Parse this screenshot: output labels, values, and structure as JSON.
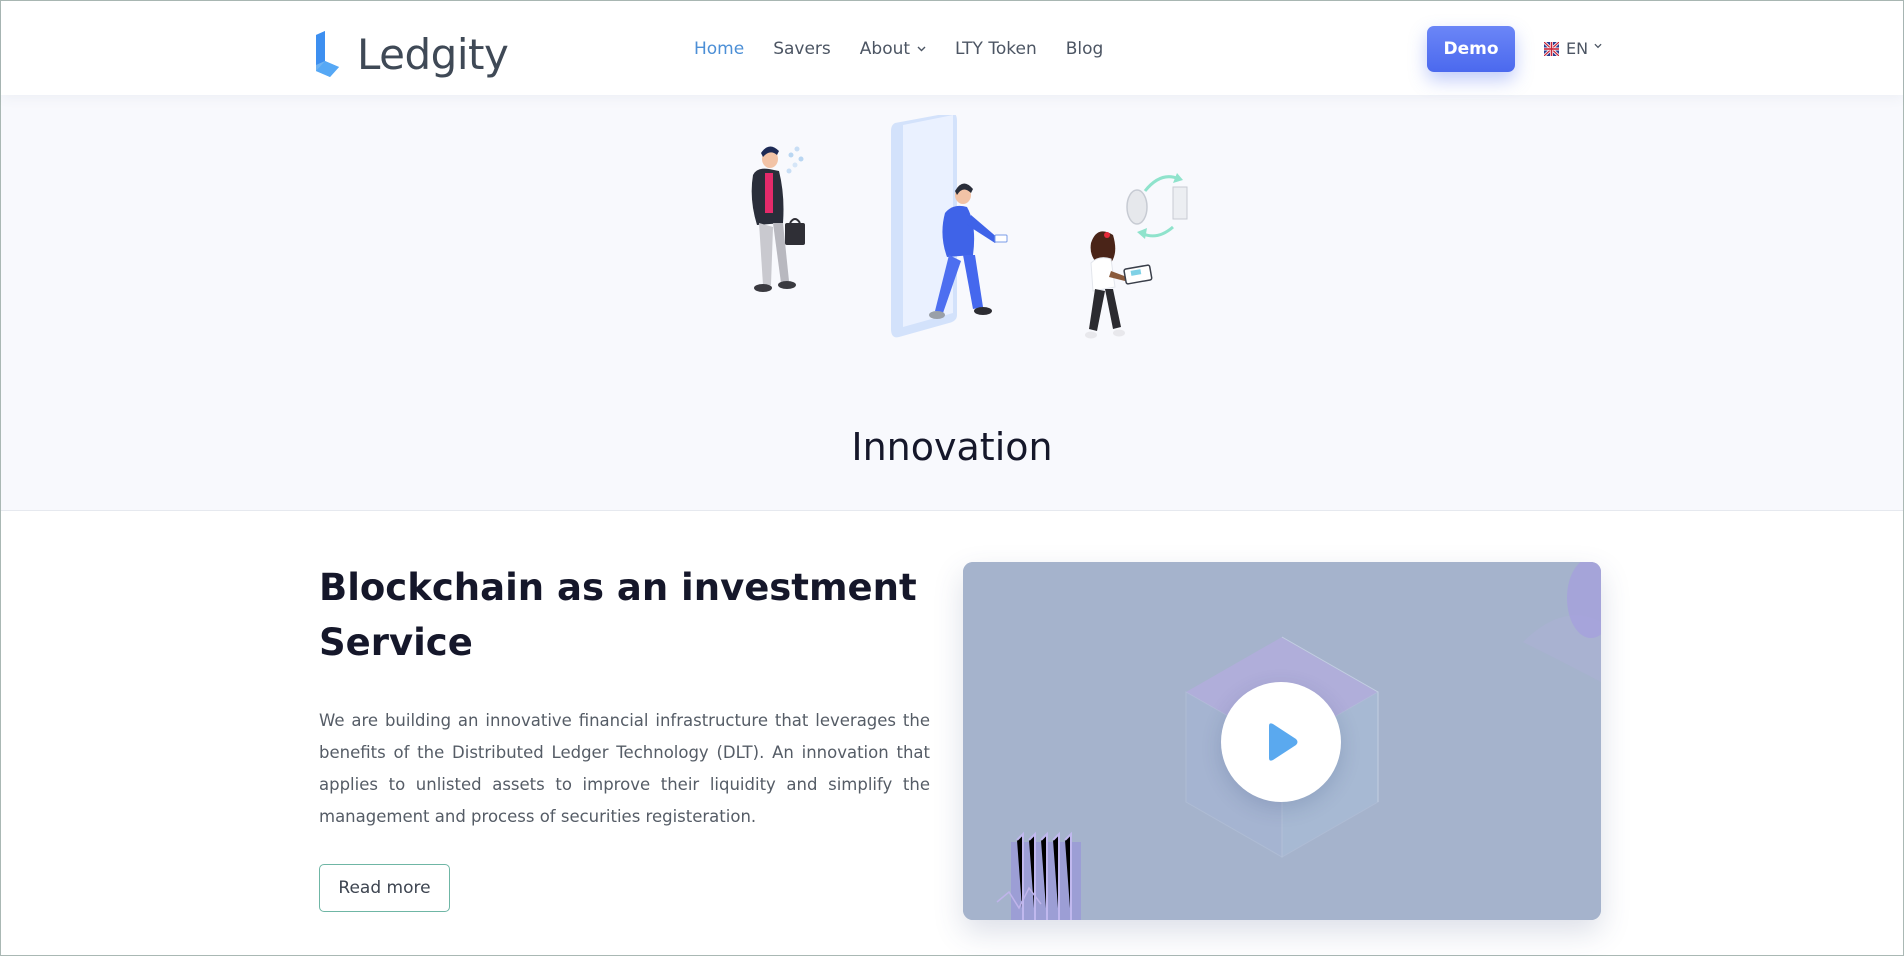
{
  "header": {
    "logo_text": "Ledgity",
    "nav": [
      {
        "label": "Home",
        "active": true
      },
      {
        "label": "Savers"
      },
      {
        "label": "About",
        "has_dropdown": true
      },
      {
        "label": "LTY Token"
      },
      {
        "label": "Blog"
      }
    ],
    "demo_label": "Demo",
    "language": "EN"
  },
  "hero": {
    "title": "Innovation"
  },
  "section": {
    "title_line1": "Blockchain as an investment",
    "title_line2": "Service",
    "body": "We are building an innovative financial infrastructure that leverages the benefits of the Distributed Ledger Technology (DLT). An innovation that applies to unlisted assets to improve their liquidity and simplify the management and process of securities registeration.",
    "read_more_label": "Read more"
  },
  "colors": {
    "accent": "#4c8fd6",
    "demo_button": "#5b78f2",
    "play_icon": "#5aa9ef",
    "read_more_border": "#6fb6a5"
  },
  "icons": {
    "logo": "ledgity-logo-icon",
    "flag": "uk-flag-icon",
    "play": "play-icon",
    "chevron": "chevron-down-icon"
  }
}
